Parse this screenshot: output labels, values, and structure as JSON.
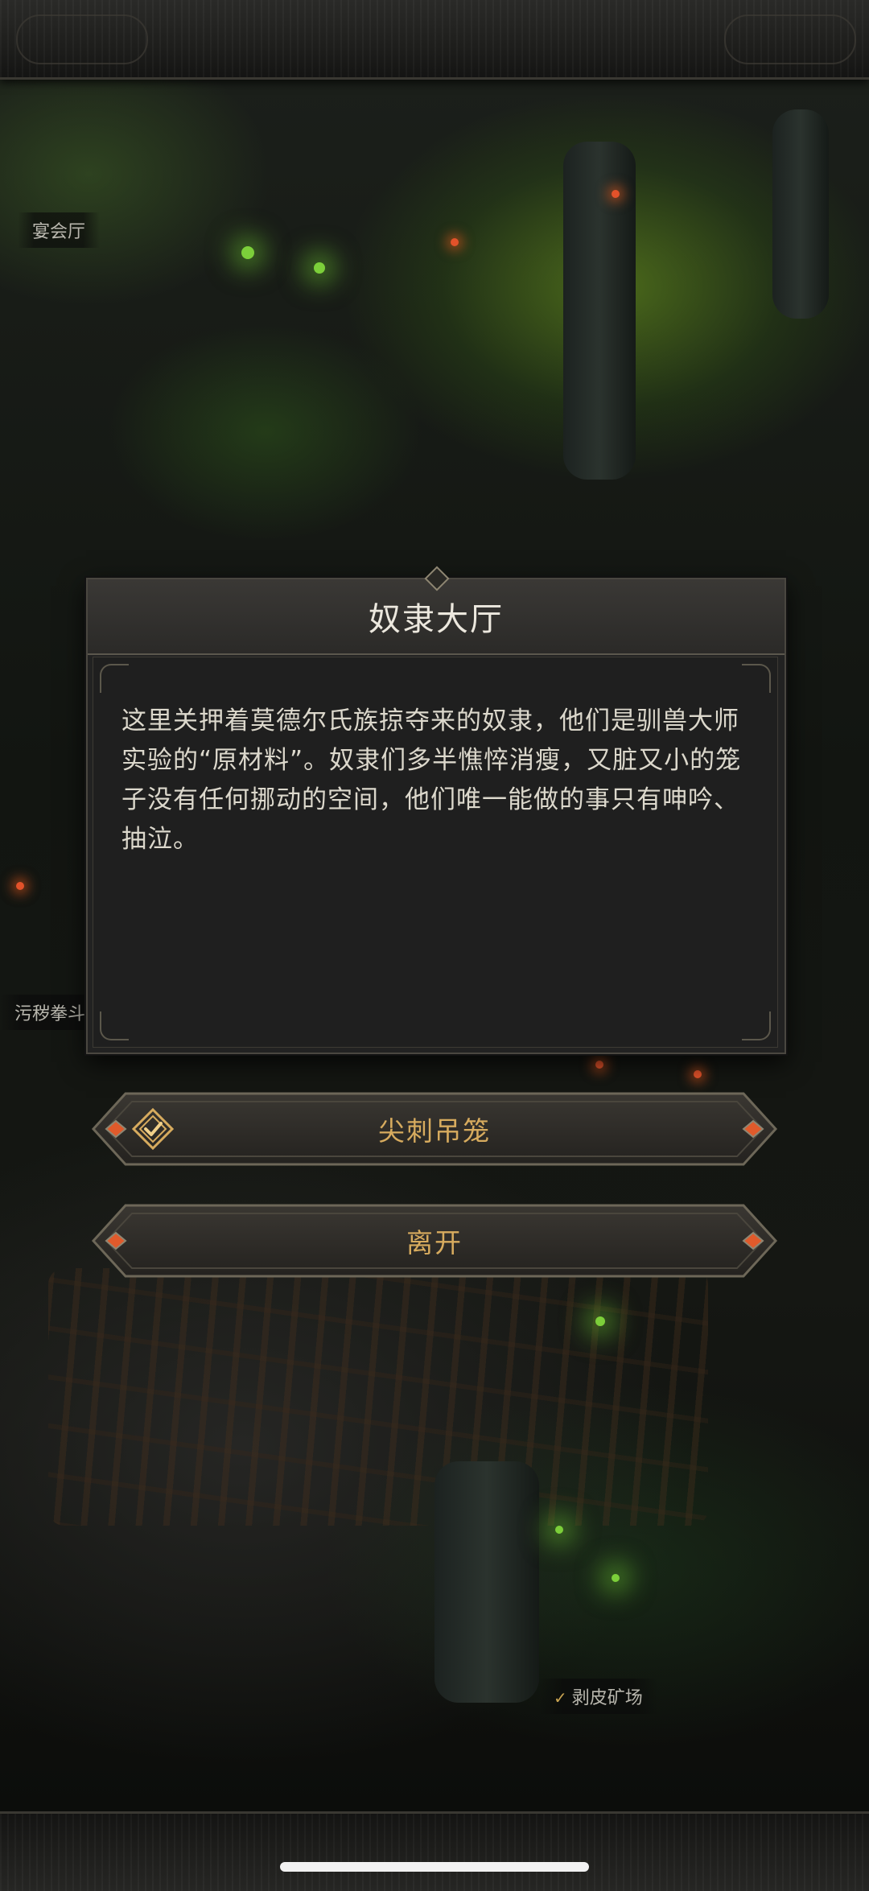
{
  "dialog": {
    "title": "奴隶大厅",
    "description": "这里关押着莫德尔氏族掠夺来的奴隶，他们是驯兽大师实验的“原材料”。奴隶们多半憔悴消瘦，又脏又小的笼子没有任何挪动的空间，他们唯一能做的事只有呻吟、抽泣。"
  },
  "options": [
    {
      "label": "尖刺吊笼",
      "icon": "completed-check-icon",
      "completed": true
    },
    {
      "label": "离开",
      "icon": null,
      "completed": false
    }
  ],
  "map_labels": {
    "banquet_hall": "宴会厅",
    "fight_pit": "污秽拳斗",
    "skinning_mine": "剥皮矿场",
    "skinning_mine_icon": "checkmark-icon"
  },
  "colors": {
    "option_text": "#d7ab5e",
    "option_gem": "#e05a2b",
    "title_text": "#ece8de",
    "body_text": "#dcd8cc",
    "green_glow": "#7ccf3a"
  }
}
